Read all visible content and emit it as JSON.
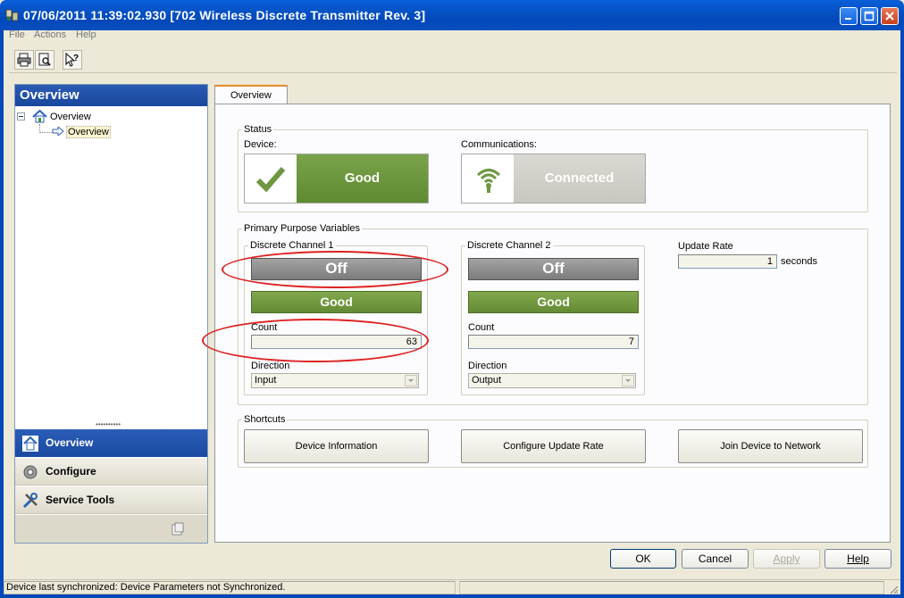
{
  "window": {
    "title": "07/06/2011 11:39:02.930 [702 Wireless Discrete Transmitter Rev. 3]"
  },
  "menu": {
    "file": "File",
    "actions": "Actions",
    "help": "Help"
  },
  "toolbar": {
    "icons": [
      "print-icon",
      "print-preview-icon",
      "context-help-icon"
    ]
  },
  "left": {
    "header": "Overview",
    "tree": {
      "root": "Overview",
      "child": "Overview"
    },
    "nav": [
      {
        "label": "Overview",
        "icon": "home-icon",
        "active": true
      },
      {
        "label": "Configure",
        "icon": "gear-icon",
        "active": false
      },
      {
        "label": "Service Tools",
        "icon": "tools-icon",
        "active": false
      }
    ]
  },
  "tab": {
    "label": "Overview"
  },
  "status": {
    "group": "Status",
    "device_label": "Device:",
    "device_value": "Good",
    "comm_label": "Communications:",
    "comm_value": "Connected"
  },
  "ppv": {
    "group": "Primary Purpose Variables",
    "ch1": {
      "title": "Discrete Channel 1",
      "state": "Off",
      "status": "Good",
      "count_label": "Count",
      "count": "63",
      "direction_label": "Direction",
      "direction": "Input"
    },
    "ch2": {
      "title": "Discrete Channel 2",
      "state": "Off",
      "status": "Good",
      "count_label": "Count",
      "count": "7",
      "direction_label": "Direction",
      "direction": "Output"
    },
    "update_rate_label": "Update Rate",
    "update_rate": "1",
    "update_rate_unit": "seconds"
  },
  "shortcuts": {
    "group": "Shortcuts",
    "buttons": [
      "Device Information",
      "Configure Update Rate",
      "Join Device to Network"
    ]
  },
  "dialog": {
    "ok": "OK",
    "cancel": "Cancel",
    "apply": "Apply",
    "help": "Help"
  },
  "statusbar": {
    "text": "Device last synchronized: Device Parameters not Synchronized."
  },
  "colors": {
    "titlebar": "#0451c4",
    "good": "#6f9641",
    "off": "#8c8c8c",
    "highlight": "#dd2222"
  }
}
